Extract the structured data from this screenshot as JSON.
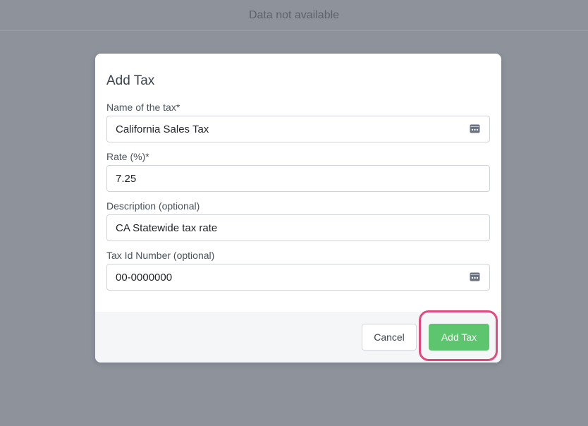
{
  "page": {
    "background_status": "Data not available"
  },
  "modal": {
    "title": "Add Tax",
    "fields": [
      {
        "label": "Name of the tax*",
        "value": "California Sales Tax",
        "icon": "password-manager-icon"
      },
      {
        "label": "Rate (%)*",
        "value": "7.25"
      },
      {
        "label": "Description (optional)",
        "value": "CA Statewide tax rate"
      },
      {
        "label": "Tax Id Number (optional)",
        "value": "00-0000000",
        "icon": "password-manager-icon"
      }
    ],
    "buttons": {
      "cancel": "Cancel",
      "submit": "Add Tax"
    }
  },
  "colors": {
    "overlay": "#8d929b",
    "submit": "#5cc56d",
    "highlight": "#e24a7d"
  }
}
